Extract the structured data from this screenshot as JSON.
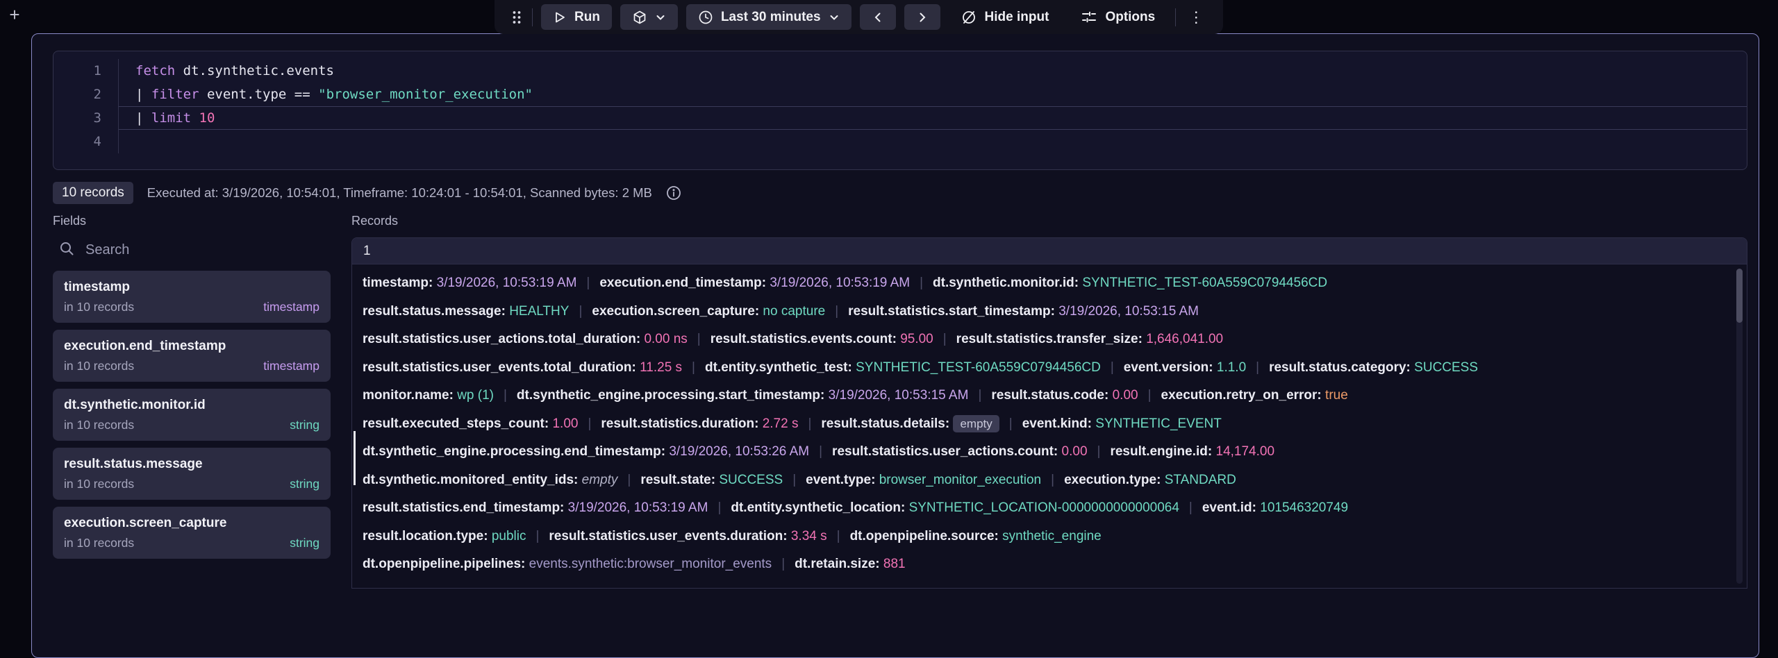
{
  "page": {
    "add_button_label": "+"
  },
  "colors": {
    "accent_keyword": "#c68fe8",
    "accent_timestamp": "#c9a6ec",
    "accent_string": "#6fdac2",
    "accent_number": "#f273b5",
    "accent_boolean": "#ec9a67",
    "container_border": "#8a8ac8"
  },
  "icons": {
    "drag-handle-icon": "six-dot-grip",
    "run-icon": "play-triangle",
    "visualization-icon": "cube",
    "chevron-down-icon": "chevron-down",
    "clock-icon": "clock",
    "prev-icon": "chevron-left",
    "next-icon": "chevron-right",
    "hide-input-icon": "eye-slash",
    "options-icon": "sliders",
    "kebab-icon": "vertical-ellipsis",
    "search-icon": "magnifier",
    "info-icon": "circled-i"
  },
  "toolbar": {
    "run_label": "Run",
    "time_label": "Last 30 minutes",
    "hide_input_label": "Hide input",
    "options_label": "Options",
    "kebab_label": "⋮"
  },
  "editor": {
    "lines": [
      {
        "num": "1",
        "current": false,
        "tokens": [
          {
            "text": "fetch",
            "style": "keyword"
          },
          {
            "text": " dt.synthetic.events",
            "style": "plain"
          }
        ]
      },
      {
        "num": "2",
        "current": false,
        "tokens": [
          {
            "text": "| ",
            "style": "plain"
          },
          {
            "text": "filter",
            "style": "keyword"
          },
          {
            "text": " event.type == ",
            "style": "plain"
          },
          {
            "text": "\"browser_monitor_execution\"",
            "style": "string"
          }
        ]
      },
      {
        "num": "3",
        "current": true,
        "tokens": [
          {
            "text": "| ",
            "style": "plain"
          },
          {
            "text": "limit",
            "style": "keyword"
          },
          {
            "text": " ",
            "style": "plain"
          },
          {
            "text": "10",
            "style": "number"
          }
        ]
      },
      {
        "num": "4",
        "current": false,
        "tokens": []
      }
    ]
  },
  "results_bar": {
    "records_badge": "10 records",
    "execution_info": "Executed at: 3/19/2026, 10:54:01, Timeframe: 10:24:01 - 10:54:01, Scanned bytes: 2 MB"
  },
  "fields_panel": {
    "title": "Fields",
    "search_placeholder": "Search",
    "fields": [
      {
        "name": "timestamp",
        "occurrence": "in 10 records",
        "type": "timestamp"
      },
      {
        "name": "execution.end_timestamp",
        "occurrence": "in 10 records",
        "type": "timestamp"
      },
      {
        "name": "dt.synthetic.monitor.id",
        "occurrence": "in 10 records",
        "type": "string"
      },
      {
        "name": "result.status.message",
        "occurrence": "in 10 records",
        "type": "string"
      },
      {
        "name": "execution.screen_capture",
        "occurrence": "in 10 records",
        "type": "string"
      }
    ]
  },
  "records_panel": {
    "title": "Records",
    "row_index": "1",
    "lines": [
      [
        {
          "key": "timestamp",
          "value": "3/19/2026, 10:53:19 AM",
          "type": "timestamp"
        },
        {
          "key": "execution.end_timestamp",
          "value": "3/19/2026, 10:53:19 AM",
          "type": "timestamp"
        },
        {
          "key": "dt.synthetic.monitor.id",
          "value": "SYNTHETIC_TEST-60A559C0794456CD",
          "type": "string"
        }
      ],
      [
        {
          "key": "result.status.message",
          "value": "HEALTHY",
          "type": "string"
        },
        {
          "key": "execution.screen_capture",
          "value": "no capture",
          "type": "string"
        },
        {
          "key": "result.statistics.start_timestamp",
          "value": "3/19/2026, 10:53:15 AM",
          "type": "timestamp"
        }
      ],
      [
        {
          "key": "result.statistics.user_actions.total_duration",
          "value": "0.00 ns",
          "type": "number"
        },
        {
          "key": "result.statistics.events.count",
          "value": "95.00",
          "type": "number"
        },
        {
          "key": "result.statistics.transfer_size",
          "value": "1,646,041.00",
          "type": "number"
        }
      ],
      [
        {
          "key": "result.statistics.user_events.total_duration",
          "value": "11.25 s",
          "type": "number"
        },
        {
          "key": "dt.entity.synthetic_test",
          "value": "SYNTHETIC_TEST-60A559C0794456CD",
          "type": "string"
        },
        {
          "key": "event.version",
          "value": "1.1.0",
          "type": "string"
        },
        {
          "key": "result.status.category",
          "value": "SUCCESS",
          "type": "string"
        }
      ],
      [
        {
          "key": "monitor.name",
          "value": "wp (1)",
          "type": "string"
        },
        {
          "key": "dt.synthetic_engine.processing.start_timestamp",
          "value": "3/19/2026, 10:53:15 AM",
          "type": "timestamp"
        },
        {
          "key": "result.status.code",
          "value": "0.00",
          "type": "number"
        },
        {
          "key": "execution.retry_on_error",
          "value": "true",
          "type": "boolean"
        }
      ],
      [
        {
          "key": "result.executed_steps_count",
          "value": "1.00",
          "type": "number"
        },
        {
          "key": "result.statistics.duration",
          "value": "2.72 s",
          "type": "number"
        },
        {
          "key": "result.status.details",
          "value": "empty",
          "type": "empty-badge"
        },
        {
          "key": "event.kind",
          "value": "SYNTHETIC_EVENT",
          "type": "string"
        }
      ],
      [
        {
          "key": "dt.synthetic_engine.processing.end_timestamp",
          "value": "3/19/2026, 10:53:26 AM",
          "type": "timestamp"
        },
        {
          "key": "result.statistics.user_actions.count",
          "value": "0.00",
          "type": "number"
        },
        {
          "key": "result.engine.id",
          "value": "14,174.00",
          "type": "number"
        }
      ],
      [
        {
          "key": "dt.synthetic.monitored_entity_ids",
          "value": "empty",
          "type": "empty"
        },
        {
          "key": "result.state",
          "value": "SUCCESS",
          "type": "string"
        },
        {
          "key": "event.type",
          "value": "browser_monitor_execution",
          "type": "string"
        },
        {
          "key": "execution.type",
          "value": "STANDARD",
          "type": "string"
        }
      ],
      [
        {
          "key": "result.statistics.end_timestamp",
          "value": "3/19/2026, 10:53:19 AM",
          "type": "timestamp"
        },
        {
          "key": "dt.entity.synthetic_location",
          "value": "SYNTHETIC_LOCATION-0000000000000064",
          "type": "string"
        },
        {
          "key": "event.id",
          "value": "101546320749",
          "type": "string"
        }
      ],
      [
        {
          "key": "result.location.type",
          "value": "public",
          "type": "string"
        },
        {
          "key": "result.statistics.user_events.duration",
          "value": "3.34 s",
          "type": "number"
        },
        {
          "key": "dt.openpipeline.source",
          "value": "synthetic_engine",
          "type": "string"
        }
      ],
      [
        {
          "key": "dt.openpipeline.pipelines",
          "value": "events.synthetic:browser_monitor_events",
          "type": "muted"
        },
        {
          "key": "dt.retain.size",
          "value": "881",
          "type": "number"
        }
      ]
    ]
  }
}
